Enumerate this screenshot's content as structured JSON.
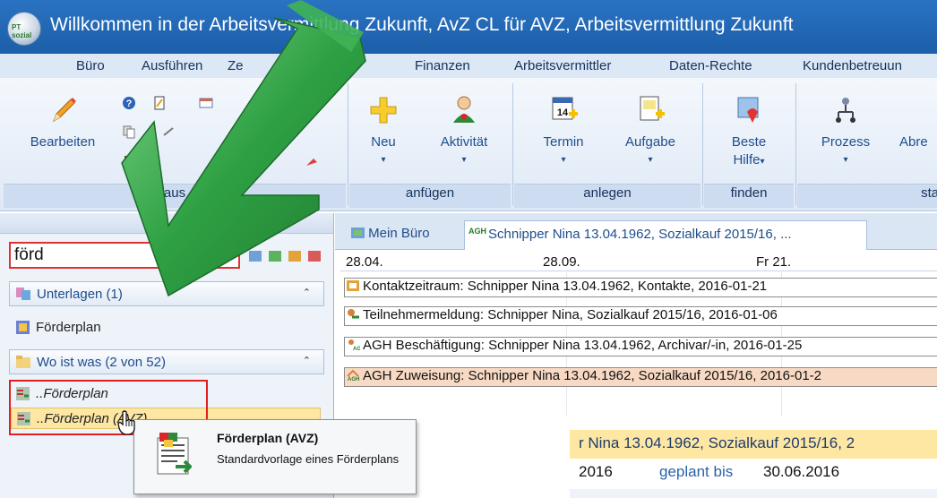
{
  "window": {
    "title": "Willkommen in der Arbeitsvermittlung Zukunft, AvZ CL für AVZ, Arbeitsvermittlung Zukunft",
    "logo_text": "PT sozial"
  },
  "menu": [
    "Büro",
    "Ausführen",
    "Ze",
    "Finanzen",
    "Arbeitsvermittler",
    "Daten-Rechte",
    "Kundenbetreuun"
  ],
  "ribbon": {
    "edit_label": "Bearbeiten",
    "group_aus_label": "aus",
    "new_label": "Neu",
    "activity_label": "Aktivität",
    "group_append_label": "anfügen",
    "appointment_label": "Termin",
    "appointment_day": "14",
    "task_label": "Aufgabe",
    "group_create_label": "anlegen",
    "best_label": "Beste",
    "help_label": "Hilfe",
    "group_find_label": "finden",
    "process_label": "Prozess",
    "abr_label": "Abre",
    "group_start_label": "starten"
  },
  "left": {
    "search_value": "förd",
    "section1": "Unterlagen (1)",
    "section1_item": "Förderplan",
    "section2": "Wo ist was (2 von 52)",
    "section2_items": [
      "..Förderplan",
      "..Förderplan (AVZ)"
    ]
  },
  "tabs": {
    "tab1": "Mein Büro",
    "tab2_badge": "AGH",
    "tab2": "Schnipper Nina 13.04.1962, Sozialkauf 2015/16, ..."
  },
  "timeline": {
    "labels": [
      "28.04.",
      "28.09.",
      "Fr 21."
    ],
    "items": [
      {
        "text": "Kontaktzeitraum: Schnipper Nina 13.04.1962, Kontakte, 2016-01-21",
        "color": "#ffffff"
      },
      {
        "text": "Teilnehmermeldung: Schnipper Nina, Sozialkauf 2015/16, 2016-01-06",
        "color": "#ffffff"
      },
      {
        "text": "AGH Beschäftigung: Schnipper Nina 13.04.1962, Archivar/-in, 2016-01-25",
        "color": "#ffffff"
      },
      {
        "text": "AGH Zuweisung: Schnipper Nina 13.04.1962, Sozialkauf 2015/16, 2016-01-2",
        "color": "#f7d9c4"
      }
    ]
  },
  "info": {
    "headline": "r Nina 13.04.1962, Sozialkauf 2015/16, 2",
    "year": "2016",
    "planned_label": "geplant bis",
    "planned_date": "30.06.2016"
  },
  "tooltip": {
    "title": "Förderplan (AVZ)",
    "description": "Standardvorlage eines Förderplans"
  },
  "colors": {
    "accent": "#1c5ea9",
    "highlight": "#e02020",
    "arrow": "#2ea043",
    "selected": "#fde7a3"
  }
}
